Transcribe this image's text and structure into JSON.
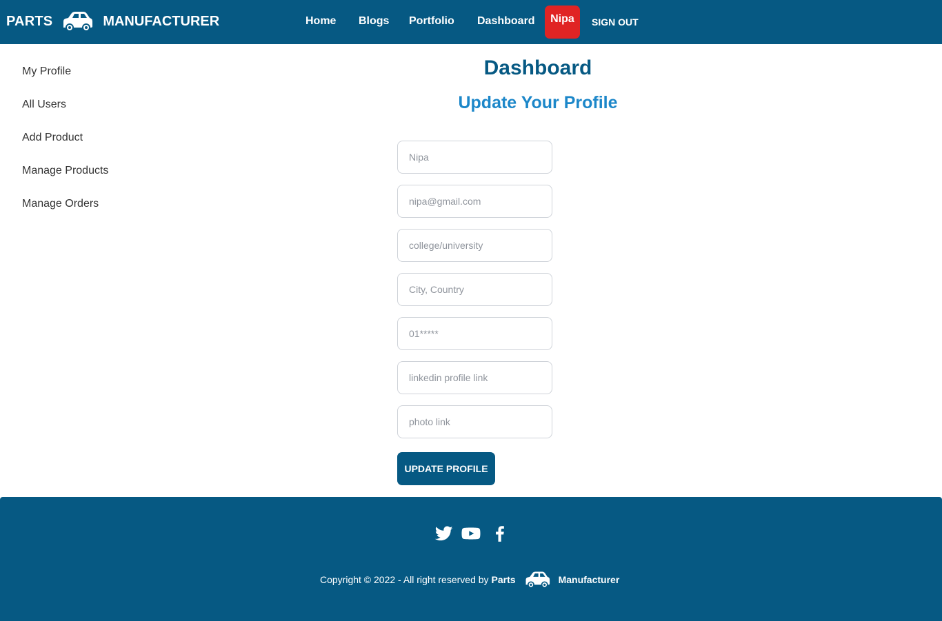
{
  "header": {
    "brand_parts": "PARTS",
    "brand_manufacturer": "MANUFACTURER",
    "nav": [
      {
        "label": "Home"
      },
      {
        "label": "Blogs"
      },
      {
        "label": "Portfolio"
      },
      {
        "label": "Dashboard"
      }
    ],
    "user_name": "Nipa",
    "sign_out": "SIGN OUT"
  },
  "sidebar": {
    "items": [
      {
        "label": "My Profile"
      },
      {
        "label": "All Users"
      },
      {
        "label": "Add Product"
      },
      {
        "label": "Manage Products"
      },
      {
        "label": "Manage Orders"
      }
    ]
  },
  "main": {
    "title": "Dashboard",
    "subtitle": "Update Your Profile",
    "fields": [
      {
        "placeholder": "Nipa",
        "value": ""
      },
      {
        "placeholder": "nipa@gmail.com",
        "value": ""
      },
      {
        "placeholder": "college/university",
        "value": ""
      },
      {
        "placeholder": "City, Country",
        "value": ""
      },
      {
        "placeholder": "01*****",
        "value": ""
      },
      {
        "placeholder": "linkedin profile link",
        "value": ""
      },
      {
        "placeholder": "photo link",
        "value": ""
      }
    ],
    "submit_label": "UPDATE PROFILE"
  },
  "footer": {
    "social_icons": [
      "twitter-icon",
      "youtube-icon",
      "facebook-icon"
    ],
    "copyright_text": "Copyright © 2022 - All right reserved by",
    "brand_parts": "Parts",
    "brand_manufacturer": "Manufacturer"
  },
  "colors": {
    "primary": "#065983",
    "accent_blue": "#1c87c9",
    "user_badge": "#e02424",
    "white": "#ffffff"
  }
}
